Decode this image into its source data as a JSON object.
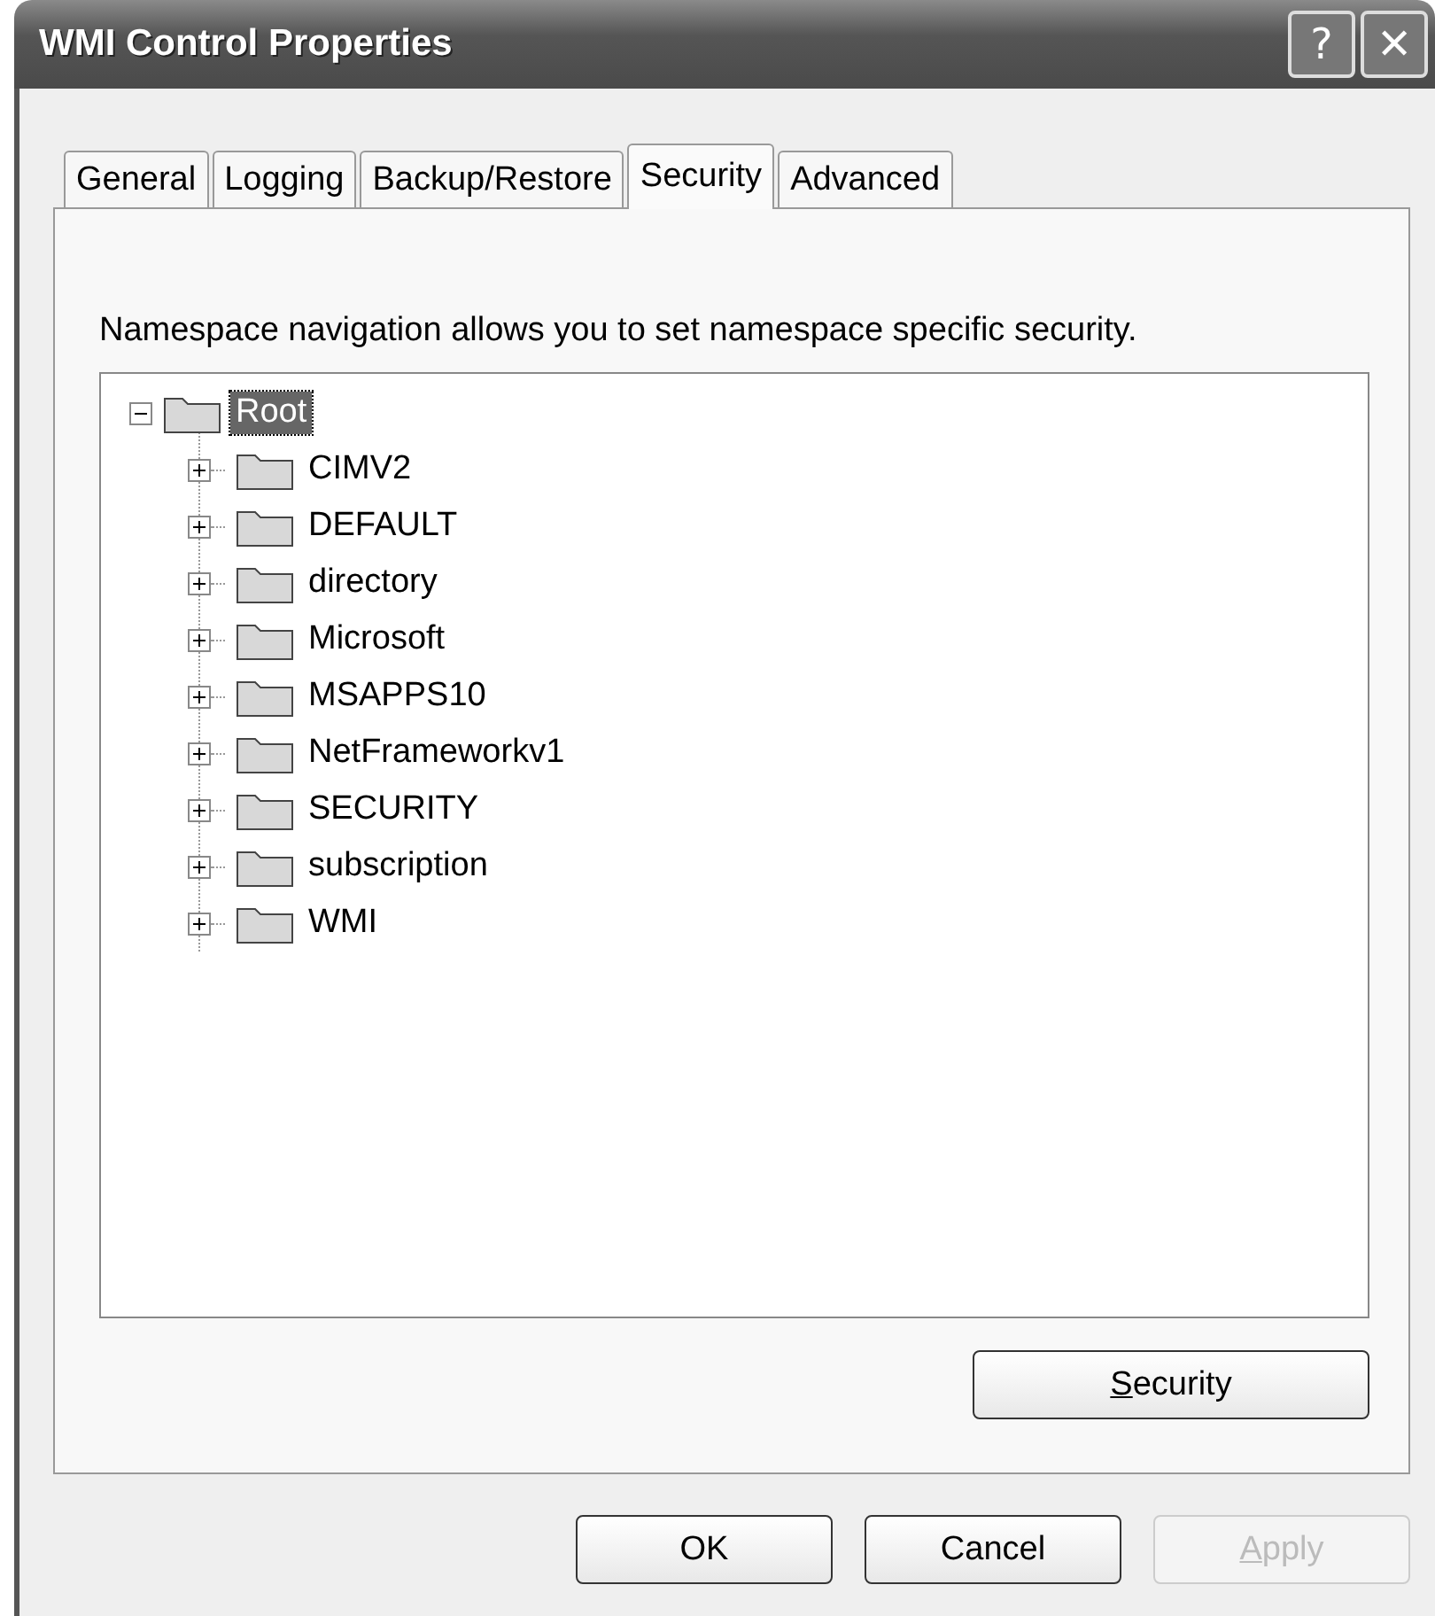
{
  "window": {
    "title": "WMI Control Properties",
    "help_glyph": "?",
    "close_glyph": "✕"
  },
  "tabs": [
    {
      "label": "General",
      "selected": false
    },
    {
      "label": "Logging",
      "selected": false
    },
    {
      "label": "Backup/Restore",
      "selected": false
    },
    {
      "label": "Security",
      "selected": true
    },
    {
      "label": "Advanced",
      "selected": false
    }
  ],
  "description": "Namespace navigation allows you to set namespace specific security.",
  "tree": [
    {
      "label": "Root",
      "expanded": true,
      "selected": true,
      "children": [
        {
          "label": "CIMV2",
          "expanded": false,
          "selected": false
        },
        {
          "label": "DEFAULT",
          "expanded": false,
          "selected": false
        },
        {
          "label": "directory",
          "expanded": false,
          "selected": false
        },
        {
          "label": "Microsoft",
          "expanded": false,
          "selected": false
        },
        {
          "label": "MSAPPS10",
          "expanded": false,
          "selected": false
        },
        {
          "label": "NetFrameworkv1",
          "expanded": false,
          "selected": false
        },
        {
          "label": "SECURITY",
          "expanded": false,
          "selected": false
        },
        {
          "label": "subscription",
          "expanded": false,
          "selected": false
        },
        {
          "label": "WMI",
          "expanded": false,
          "selected": false
        }
      ]
    }
  ],
  "security_button": {
    "label": "Security",
    "underline_first": true,
    "disabled": false
  },
  "buttons": [
    {
      "label": "OK",
      "underline_first": false,
      "disabled": false
    },
    {
      "label": "Cancel",
      "underline_first": false,
      "disabled": false
    },
    {
      "label": "Apply",
      "underline_first": true,
      "disabled": true
    }
  ]
}
